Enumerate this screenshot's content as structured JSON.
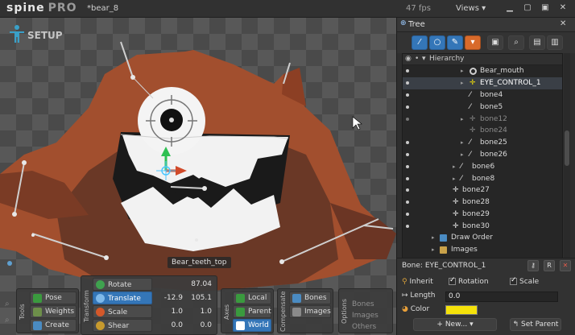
{
  "titlebar": {
    "app_name": "spine",
    "edition": "PRO",
    "filename": "*bear_8",
    "fps": "47 fps",
    "views_label": "Views"
  },
  "viewport": {
    "mode_label": "SETUP",
    "hover_bone_label": "Bear_teeth_top"
  },
  "tools": {
    "group_label": "Tools",
    "buttons": [
      "Pose",
      "Weights",
      "Create"
    ]
  },
  "transform": {
    "group_label": "Transform",
    "rows": [
      {
        "label": "Rotate",
        "v1": "",
        "v2": "87.04"
      },
      {
        "label": "Translate",
        "v1": "-12.9",
        "v2": "105.1"
      },
      {
        "label": "Scale",
        "v1": "1.0",
        "v2": "1.0"
      },
      {
        "label": "Shear",
        "v1": "0.0",
        "v2": "0.0"
      }
    ]
  },
  "axes": {
    "group_label": "Axes",
    "buttons": [
      "Local",
      "Parent",
      "World"
    ]
  },
  "compensate": {
    "group_label": "Compensate",
    "buttons": [
      "Bones",
      "Images"
    ]
  },
  "options": {
    "group_label": "Options",
    "items": [
      "Bones",
      "Images",
      "Others"
    ]
  },
  "tree": {
    "title": "Tree",
    "hierarchy_label": "Hierarchy",
    "rows": [
      {
        "label": "Bear_mouth",
        "icon": "slot-icon"
      },
      {
        "label": "EYE_CONTROL_1",
        "icon": "bone-target-icon"
      },
      {
        "label": "bone4",
        "icon": "bone-icon"
      },
      {
        "label": "bone5",
        "icon": "bone-icon"
      },
      {
        "label": "bone12",
        "icon": "bone-ghost-icon"
      },
      {
        "label": "bone24",
        "icon": "bone-ghost-icon"
      },
      {
        "label": "bone25",
        "icon": "bone-icon"
      },
      {
        "label": "bone26",
        "icon": "bone-icon"
      },
      {
        "label": "bone6",
        "icon": "bone-icon"
      },
      {
        "label": "bone8",
        "icon": "bone-icon"
      },
      {
        "label": "bone27",
        "icon": "bone-target-icon"
      },
      {
        "label": "bone28",
        "icon": "bone-target-icon"
      },
      {
        "label": "bone29",
        "icon": "bone-target-icon"
      },
      {
        "label": "bone30",
        "icon": "bone-target-icon"
      },
      {
        "label": "Draw Order",
        "icon": "draw-order-icon"
      },
      {
        "label": "Images",
        "icon": "folder-icon"
      }
    ]
  },
  "bone_panel": {
    "title": "Bone: EYE_CONTROL_1",
    "inherit_label": "Inherit",
    "rotation_label": "Rotation",
    "scale_label": "Scale",
    "length_label": "Length",
    "length_value": "0.0",
    "color_label": "Color",
    "color_value": "#f5e20a",
    "new_button": "New...",
    "set_parent_button": "Set Parent"
  },
  "colors": {
    "accent_blue": "#3476b8",
    "selection_orange": "#d86a2b",
    "bear_fur": "#a24f2e",
    "bear_dark": "#4a2a1e"
  }
}
